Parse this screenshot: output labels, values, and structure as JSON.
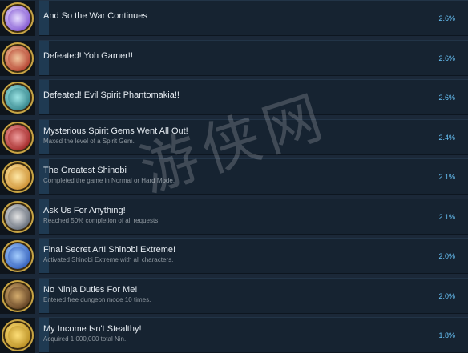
{
  "achievements": [
    {
      "title": "And So the War Continues",
      "desc": "",
      "pct": "2.6%",
      "colors": [
        "#7d4fd0",
        "#e9e0ff"
      ]
    },
    {
      "title": "Defeated! Yoh Gamer!!",
      "desc": "",
      "pct": "2.6%",
      "colors": [
        "#b23a2a",
        "#f2c9a0"
      ]
    },
    {
      "title": "Defeated! Evil Spirit Phantomakia!!",
      "desc": "",
      "pct": "2.6%",
      "colors": [
        "#2e7f86",
        "#9ee6e6"
      ]
    },
    {
      "title": "Mysterious Spirit Gems Went All Out!",
      "desc": "Maxed the level of a Spirit Gem.",
      "pct": "2.4%",
      "colors": [
        "#9e1f1f",
        "#f0a0a0"
      ]
    },
    {
      "title": "The Greatest Shinobi",
      "desc": "Completed the game in Normal or Hard Mode.",
      "pct": "2.1%",
      "colors": [
        "#c98a2a",
        "#ffe9a8"
      ]
    },
    {
      "title": "Ask Us For Anything!",
      "desc": "Reached 50% completion of all requests.",
      "pct": "2.1%",
      "colors": [
        "#5b6472",
        "#e6e6e6"
      ]
    },
    {
      "title": "Final Secret Art! Shinobi Extreme!",
      "desc": "Activated Shinobi Extreme with all characters.",
      "pct": "2.0%",
      "colors": [
        "#2b58b8",
        "#a7d0ff"
      ]
    },
    {
      "title": "No Ninja Duties For Me!",
      "desc": "Entered free dungeon mode 10 times.",
      "pct": "2.0%",
      "colors": [
        "#5a3a1e",
        "#d8b070"
      ]
    },
    {
      "title": "My Income Isn't Stealthy!",
      "desc": "Acquired 1,000,000 total Nin.",
      "pct": "1.8%",
      "colors": [
        "#b58a1e",
        "#ffe07a"
      ]
    }
  ],
  "watermark": "游侠网"
}
